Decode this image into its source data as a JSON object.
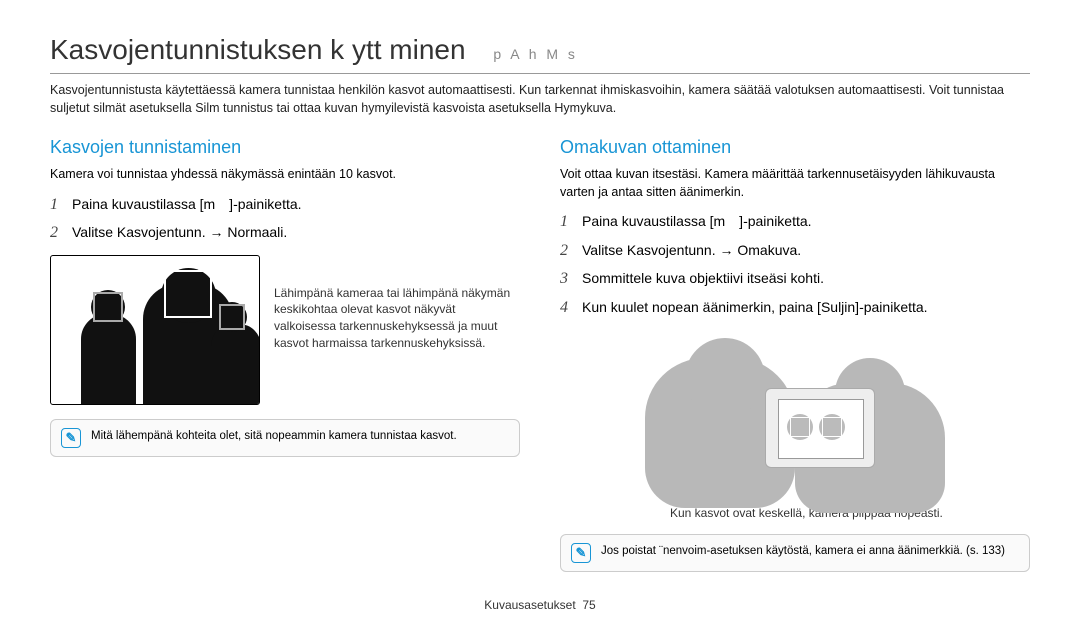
{
  "header": {
    "title": "Kasvojentunnistuksen k ytt minen",
    "modes": "p A h M s"
  },
  "intro": "Kasvojentunnistusta käytettäessä kamera tunnistaa henkilön kasvot automaattisesti. Kun tarkennat ihmiskasvoihin, kamera säätää valotuksen automaattisesti. Voit tunnistaa suljetut silmät asetuksella Silm tunnistus tai ottaa kuvan hymyilevistä kasvoista asetuksella Hymykuva.",
  "left": {
    "heading": "Kasvojen tunnistaminen",
    "desc": "Kamera voi tunnistaa yhdessä näkymässä enintään 10 kasvot.",
    "steps": [
      "Paina kuvaustilassa [m ]-painiketta.",
      "Valitse Kasvojentunn. → Normaali."
    ],
    "fig_caption": "Lähimpänä kameraa tai lähimpänä näkymän keskikohtaa olevat kasvot näkyvät valkoisessa tarkennuskehyksessä ja muut kasvot harmaissa tarkennuskehyksissä.",
    "note": "Mitä lähempänä kohteita olet, sitä nopeammin kamera tunnistaa kasvot."
  },
  "right": {
    "heading": "Omakuvan ottaminen",
    "desc": "Voit ottaa kuvan itsestäsi. Kamera määrittää tarkennusetäisyyden lähikuvausta varten ja antaa sitten äänimerkin.",
    "steps": [
      "Paina kuvaustilassa [m ]-painiketta.",
      "Valitse Kasvojentunn. → Omakuva.",
      "Sommittele kuva objektiivi itseäsi kohti.",
      "Kun kuulet nopean äänimerkin, paina [Suljin]-painiketta."
    ],
    "fig_caption": "Kun kasvot ovat keskellä, kamera piippaa nopeasti.",
    "note": "Jos poistat ¨nenvoim-asetuksen käytöstä, kamera ei anna äänimerkkiä. (s. 133)"
  },
  "footer": {
    "section": "Kuvausasetukset",
    "page": "75"
  }
}
